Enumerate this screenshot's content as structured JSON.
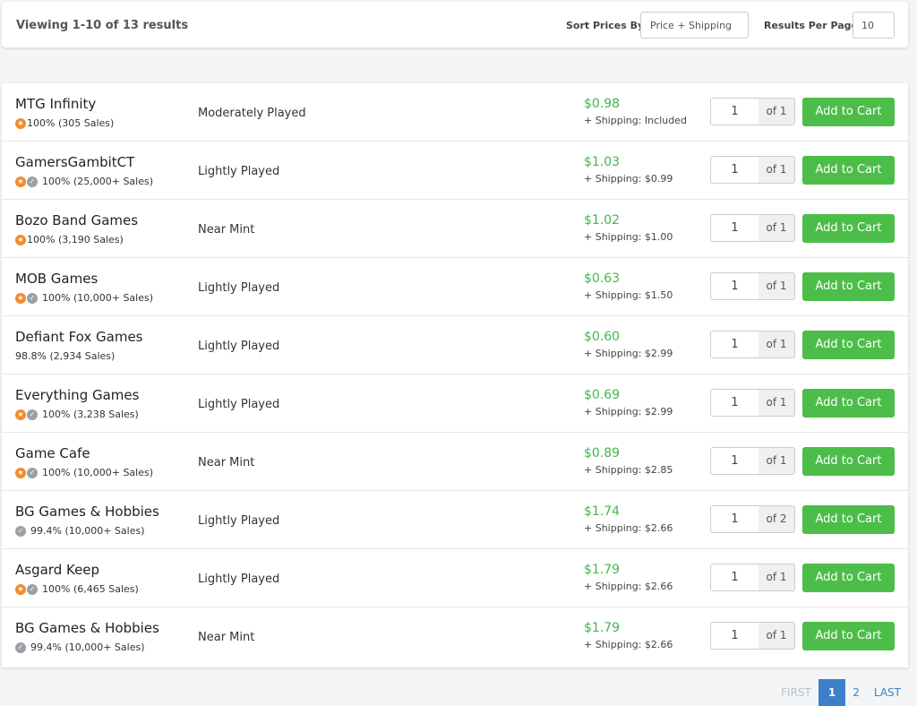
{
  "toolbar": {
    "viewing": "Viewing 1-10 of 13 results",
    "sort_label": "Sort Prices By:",
    "sort_value": "Price + Shipping",
    "rpp_label": "Results Per Page:",
    "rpp_value": "10"
  },
  "add_label": "Add to Cart",
  "listings": [
    {
      "seller": "MTG Infinity",
      "badges": [
        "gold"
      ],
      "rating": "100% (305 Sales)",
      "condition": "Moderately Played",
      "price": "$0.98",
      "shipping": "+ Shipping: Included",
      "qty": "1",
      "of": "of 1"
    },
    {
      "seller": "GamersGambitCT",
      "badges": [
        "gold",
        "verified"
      ],
      "rating": "100% (25,000+ Sales)",
      "condition": "Lightly Played",
      "price": "$1.03",
      "shipping": "+ Shipping: $0.99",
      "qty": "1",
      "of": "of 1"
    },
    {
      "seller": "Bozo Band Games",
      "badges": [
        "gold"
      ],
      "rating": "100% (3,190 Sales)",
      "condition": "Near Mint",
      "price": "$1.02",
      "shipping": "+ Shipping: $1.00",
      "qty": "1",
      "of": "of 1"
    },
    {
      "seller": "MOB Games",
      "badges": [
        "gold",
        "verified"
      ],
      "rating": "100% (10,000+ Sales)",
      "condition": "Lightly Played",
      "price": "$0.63",
      "shipping": "+ Shipping: $1.50",
      "qty": "1",
      "of": "of 1"
    },
    {
      "seller": "Defiant Fox Games",
      "badges": [],
      "rating": "98.8% (2,934 Sales)",
      "condition": "Lightly Played",
      "price": "$0.60",
      "shipping": "+ Shipping: $2.99",
      "qty": "1",
      "of": "of 1"
    },
    {
      "seller": "Everything Games",
      "badges": [
        "gold",
        "verified"
      ],
      "rating": "100% (3,238 Sales)",
      "condition": "Lightly Played",
      "price": "$0.69",
      "shipping": "+ Shipping: $2.99",
      "qty": "1",
      "of": "of 1"
    },
    {
      "seller": "Game Cafe",
      "badges": [
        "gold",
        "verified"
      ],
      "rating": "100% (10,000+ Sales)",
      "condition": "Near Mint",
      "price": "$0.89",
      "shipping": "+ Shipping: $2.85",
      "qty": "1",
      "of": "of 1"
    },
    {
      "seller": "BG Games & Hobbies",
      "badges": [
        "verified"
      ],
      "rating": "99.4% (10,000+ Sales)",
      "condition": "Lightly Played",
      "price": "$1.74",
      "shipping": "+ Shipping: $2.66",
      "qty": "1",
      "of": "of 2"
    },
    {
      "seller": "Asgard Keep",
      "badges": [
        "gold",
        "verified"
      ],
      "rating": "100% (6,465 Sales)",
      "condition": "Lightly Played",
      "price": "$1.79",
      "shipping": "+ Shipping: $2.66",
      "qty": "1",
      "of": "of 1"
    },
    {
      "seller": "BG Games & Hobbies",
      "badges": [
        "verified"
      ],
      "rating": "99.4% (10,000+ Sales)",
      "condition": "Near Mint",
      "price": "$1.79",
      "shipping": "+ Shipping: $2.66",
      "qty": "1",
      "of": "of 1"
    }
  ],
  "pagination": {
    "first": "FIRST",
    "pages": [
      "1",
      "2"
    ],
    "current": "1",
    "last": "LAST"
  },
  "colors": {
    "price": "#44b649",
    "button": "#4cbd49",
    "gold_badge": "#f08c2c",
    "verified_badge": "#9aa0a6",
    "pager_active": "#3c80c9"
  }
}
